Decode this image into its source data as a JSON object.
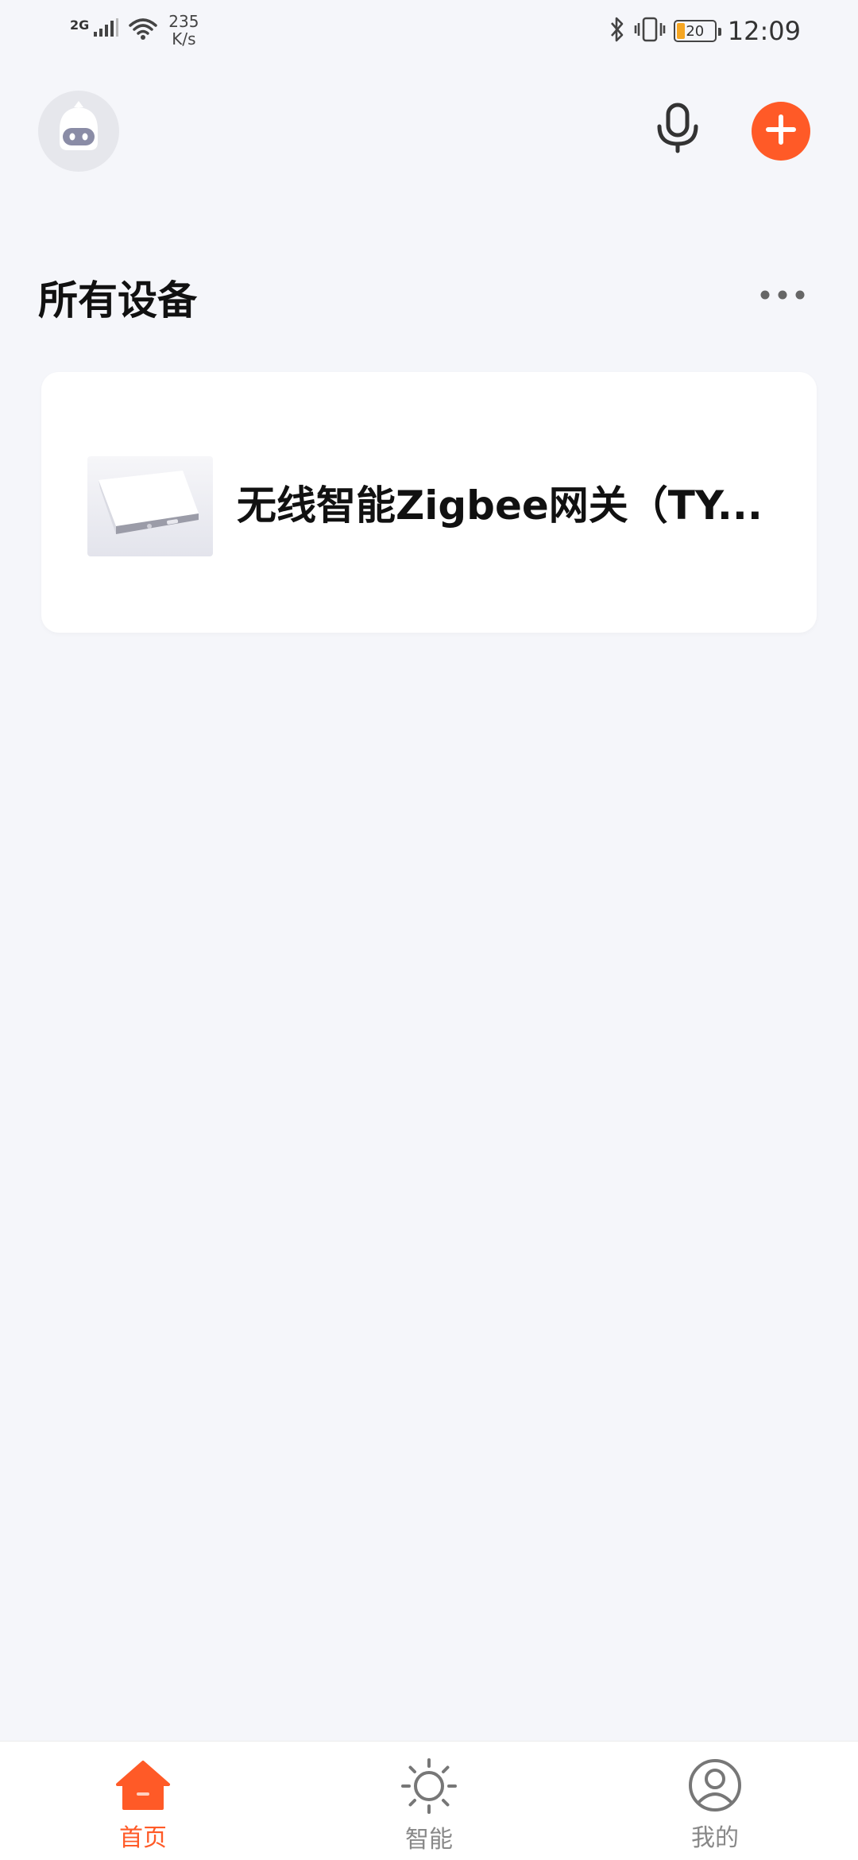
{
  "status_bar": {
    "network": "2G",
    "speed_value": "235",
    "speed_unit": "K/s",
    "battery": "20",
    "time": "12:09"
  },
  "header": {
    "avatar_icon": "robot-avatar-icon",
    "mic_icon": "microphone-icon",
    "add_icon": "plus-icon"
  },
  "section": {
    "title": "所有设备",
    "more_icon": "more-dots-icon"
  },
  "devices": [
    {
      "name": "无线智能Zigbee网关（TY...",
      "image": "gateway-device-image"
    }
  ],
  "bottom_nav": {
    "items": [
      {
        "label": "首页",
        "icon": "home-icon",
        "active": true
      },
      {
        "label": "智能",
        "icon": "sun-icon",
        "active": false
      },
      {
        "label": "我的",
        "icon": "user-icon",
        "active": false
      }
    ]
  },
  "colors": {
    "accent": "#ff5a27",
    "background": "#f5f6fa",
    "card": "#ffffff",
    "inactive": "#888888"
  }
}
